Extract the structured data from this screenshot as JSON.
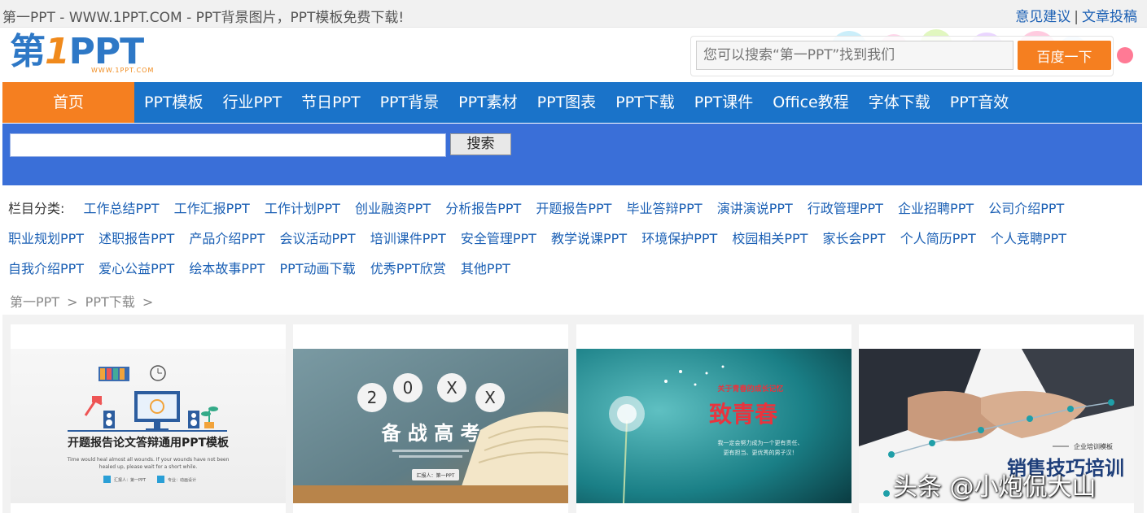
{
  "topbar": {
    "site_title": "第一PPT - WWW.1PPT.COM - PPT背景图片，PPT模板免费下载!",
    "feedback": "意见建议",
    "separator": "|",
    "submit": "文章投稿"
  },
  "logo": {
    "char1": "第",
    "char2": "1",
    "char3": "PPT",
    "domain": "WWW.1PPT.COM"
  },
  "search": {
    "placeholder": "您可以搜索“第一PPT”找到我们",
    "button": "百度一下"
  },
  "nav": {
    "items": [
      "首页",
      "PPT模板",
      "行业PPT",
      "节日PPT",
      "PPT背景",
      "PPT素材",
      "PPT图表",
      "PPT下载",
      "PPT课件",
      "Office教程",
      "字体下载",
      "PPT音效"
    ]
  },
  "site_search": {
    "button": "搜索"
  },
  "categories": {
    "label": "栏目分类:",
    "rows": [
      [
        "工作总结PPT",
        "工作汇报PPT",
        "工作计划PPT",
        "创业融资PPT",
        "分析报告PPT",
        "开题报告PPT",
        "毕业答辩PPT",
        "演讲演说PPT",
        "行政管理PPT",
        "企业招聘PPT",
        "公司介绍PPT"
      ],
      [
        "职业规划PPT",
        "述职报告PPT",
        "产品介绍PPT",
        "会议活动PPT",
        "培训课件PPT",
        "安全管理PPT",
        "教学说课PPT",
        "环境保护PPT",
        "校园相关PPT",
        "家长会PPT",
        "个人简历PPT",
        "个人竞聘PPT"
      ],
      [
        "自我介绍PPT",
        "爱心公益PPT",
        "绘本故事PPT",
        "PPT动画下载",
        "优秀PPT欣赏",
        "其他PPT"
      ]
    ]
  },
  "breadcrumb": {
    "home": "第一PPT",
    "sep": ">",
    "section": "PPT下载",
    "tail": ">"
  },
  "cards": [
    {
      "title": "开题报告论文答辩通用PPT模板",
      "subtitle1": "Time would heal almost all wounds. If your wounds have not been",
      "subtitle2": "healed up, please wait for a short while.",
      "reporter": "汇报人：第一PPT",
      "major": "专业：动画设计"
    },
    {
      "digits": [
        "2",
        "0",
        "X",
        "X"
      ],
      "title": "备 战 高 考",
      "reporter": "汇报人：第一PPT"
    },
    {
      "kicker": "关于青春的成长记忆",
      "title": "致青春",
      "line1": "我一定会努力成为一个更有责任、",
      "line2": "更有担当、更优秀的男子汉！"
    },
    {
      "kicker": "企业培训模板",
      "title": "销售技巧培训"
    }
  ],
  "watermark": "头条 @小炮侃大山",
  "colors": {
    "nav_blue": "#1a73c9",
    "accent_orange": "#f57f20",
    "search_strip": "#3a6fd8",
    "link_blue": "#1a5fb4"
  }
}
